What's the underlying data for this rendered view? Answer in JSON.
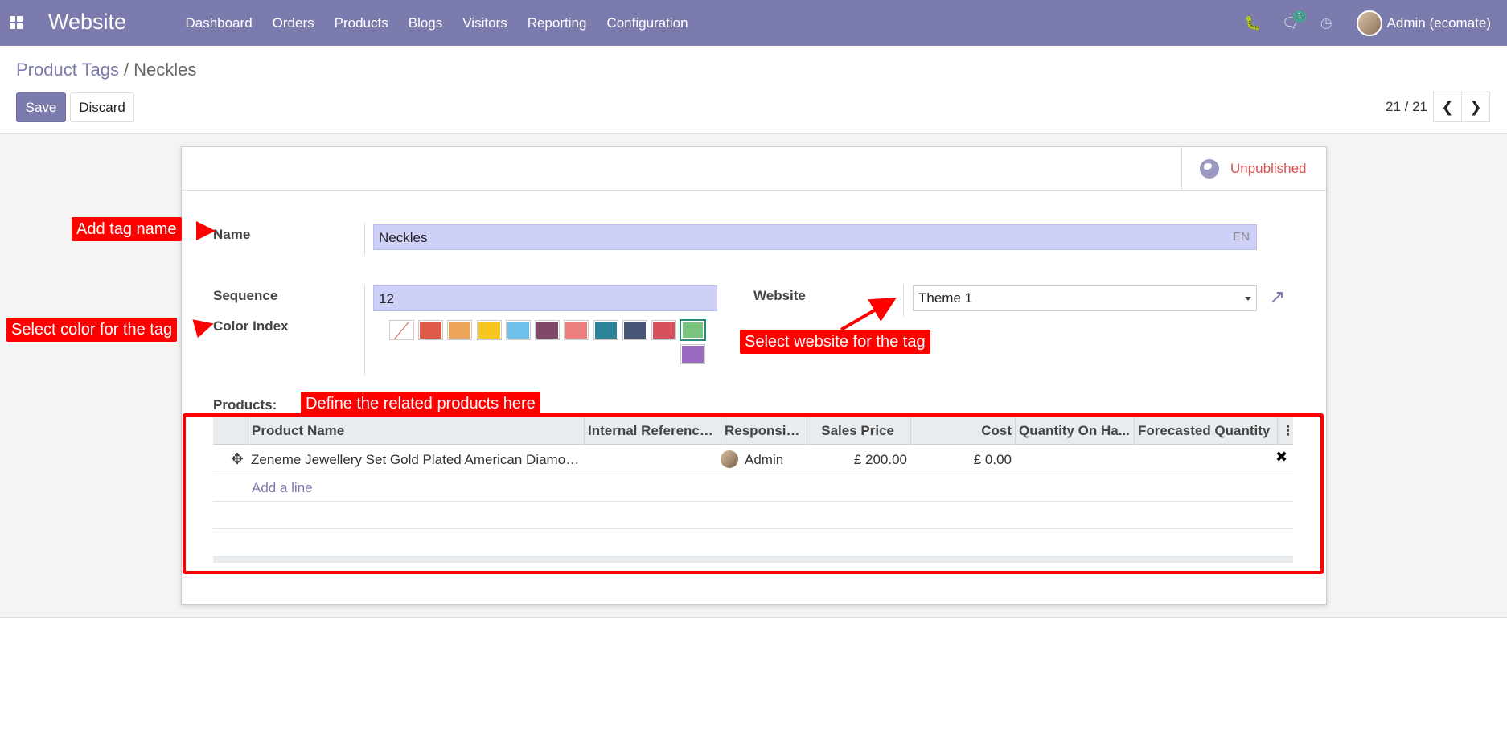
{
  "navbar": {
    "app_name": "Website",
    "menu": [
      "Dashboard",
      "Orders",
      "Products",
      "Blogs",
      "Visitors",
      "Reporting",
      "Configuration"
    ],
    "chat_count": "1",
    "user_name": "Admin (ecomate)",
    "icons": [
      "apps-grid-icon",
      "bug-icon",
      "chat-icon",
      "clock-icon"
    ]
  },
  "breadcrumb": {
    "parent": "Product Tags",
    "separator": "/",
    "current": "Neckles"
  },
  "actions": {
    "save_label": "Save",
    "discard_label": "Discard"
  },
  "pager": {
    "value": "21 / 21"
  },
  "status": {
    "label": "Unpublished"
  },
  "form": {
    "name_label": "Name",
    "name_value": "Neckles",
    "lang": "EN",
    "sequence_label": "Sequence",
    "sequence_value": "12",
    "color_label": "Color Index",
    "website_label": "Website",
    "website_value": "Theme 1",
    "products_label": "Products:"
  },
  "colors": [
    "none",
    "#e05a4a",
    "#eda55a",
    "#f6c81f",
    "#6fc0ea",
    "#814968",
    "#eb7e7f",
    "#2c8397",
    "#475577",
    "#d6145f",
    "#30c381",
    "#9365b8"
  ],
  "swatch_colors": [
    "#e05a4a",
    "#eda55a",
    "#f6c81f",
    "#6fc0ea",
    "#814968",
    "#eb7e7f",
    "#2c8397",
    "#475577",
    "#d6505e",
    "#7bc47f",
    "#9a6bc1"
  ],
  "table": {
    "columns": [
      "Product Name",
      "Internal Reference...",
      "Responsible",
      "Sales Price",
      "Cost",
      "Quantity On Ha...",
      "Forecasted Quantity"
    ],
    "rows": [
      {
        "product": "Zeneme Jewellery Set Gold Plated American Diamon...",
        "internal_ref": "",
        "responsible": "Admin",
        "sales_price": "£ 200.00",
        "cost": "£ 0.00",
        "qty_on_hand": "",
        "forecasted": ""
      }
    ],
    "add_line": "Add a line"
  },
  "annotations": {
    "tag_name": "Add tag name",
    "color": "Select color for the tag",
    "website": "Select website for the tag",
    "products": "Define the related products here"
  }
}
